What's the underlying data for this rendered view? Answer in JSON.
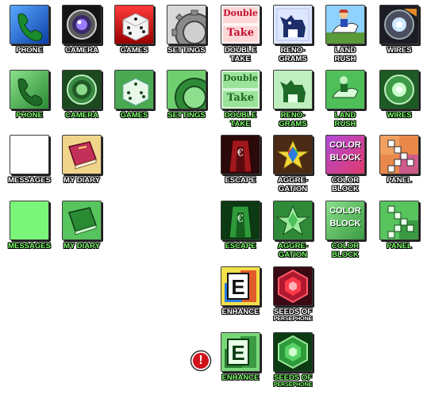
{
  "row_normal_1": {
    "phone": "PHONE",
    "camera": "CAMERA",
    "games": "GAMES",
    "settings": "SETTINGS",
    "double_take_1": "DOUBLE",
    "double_take_2": "TAKE",
    "renograms_1": "RENO-",
    "renograms_2": "GRAMS",
    "land_rush_1": "LAND",
    "land_rush_2": "RUSH",
    "wires": "WIRES",
    "double_take_art_1": "Double",
    "double_take_art_2": "Take"
  },
  "row_selected_1": {
    "phone": "PHONE",
    "camera": "CAMERA",
    "games": "GAMES",
    "settings": "SETTINGS",
    "double_take_1": "DOUBLE",
    "double_take_2": "TAKE",
    "renograms_1": "RENO-",
    "renograms_2": "GRAMS",
    "land_rush_1": "LAND",
    "land_rush_2": "RUSH",
    "wires": "WIRES",
    "double_take_art_1": "Double",
    "double_take_art_2": "Take"
  },
  "row_normal_2": {
    "messages": "MESSAGES",
    "my_diary": "MY DIARY",
    "escape": "ESCAPE",
    "aggregation_1": "AGGRE-",
    "aggregation_2": "GATION",
    "color_block_1": "COLOR",
    "color_block_2": "BLOCK",
    "panel": "PANEL",
    "color_block_art_1": "COLOR",
    "color_block_art_2": "BLOCK"
  },
  "row_selected_2": {
    "messages": "MESSAGES",
    "my_diary": "MY DIARY",
    "escape": "ESCAPE",
    "aggregation_1": "AGGRE-",
    "aggregation_2": "GATION",
    "color_block_1": "COLOR",
    "color_block_2": "BLOCK",
    "panel": "PANEL",
    "color_block_art_1": "COLOR",
    "color_block_art_2": "BLOCK"
  },
  "row_normal_3": {
    "enhance": "ENHANCE",
    "seeds_1": "SEEDS OF",
    "seeds_2": "PERSEPHONE"
  },
  "row_selected_3": {
    "enhance": "ENHANCE",
    "seeds_1": "SEEDS OF",
    "seeds_2": "PERSEPHONE"
  },
  "alert": {
    "glyph": "!"
  },
  "colors": {
    "selected_label": "#7dff6a",
    "normal_label": "#ffffff",
    "green_tile": "#3fae4a",
    "alert_red": "#d0121b"
  }
}
